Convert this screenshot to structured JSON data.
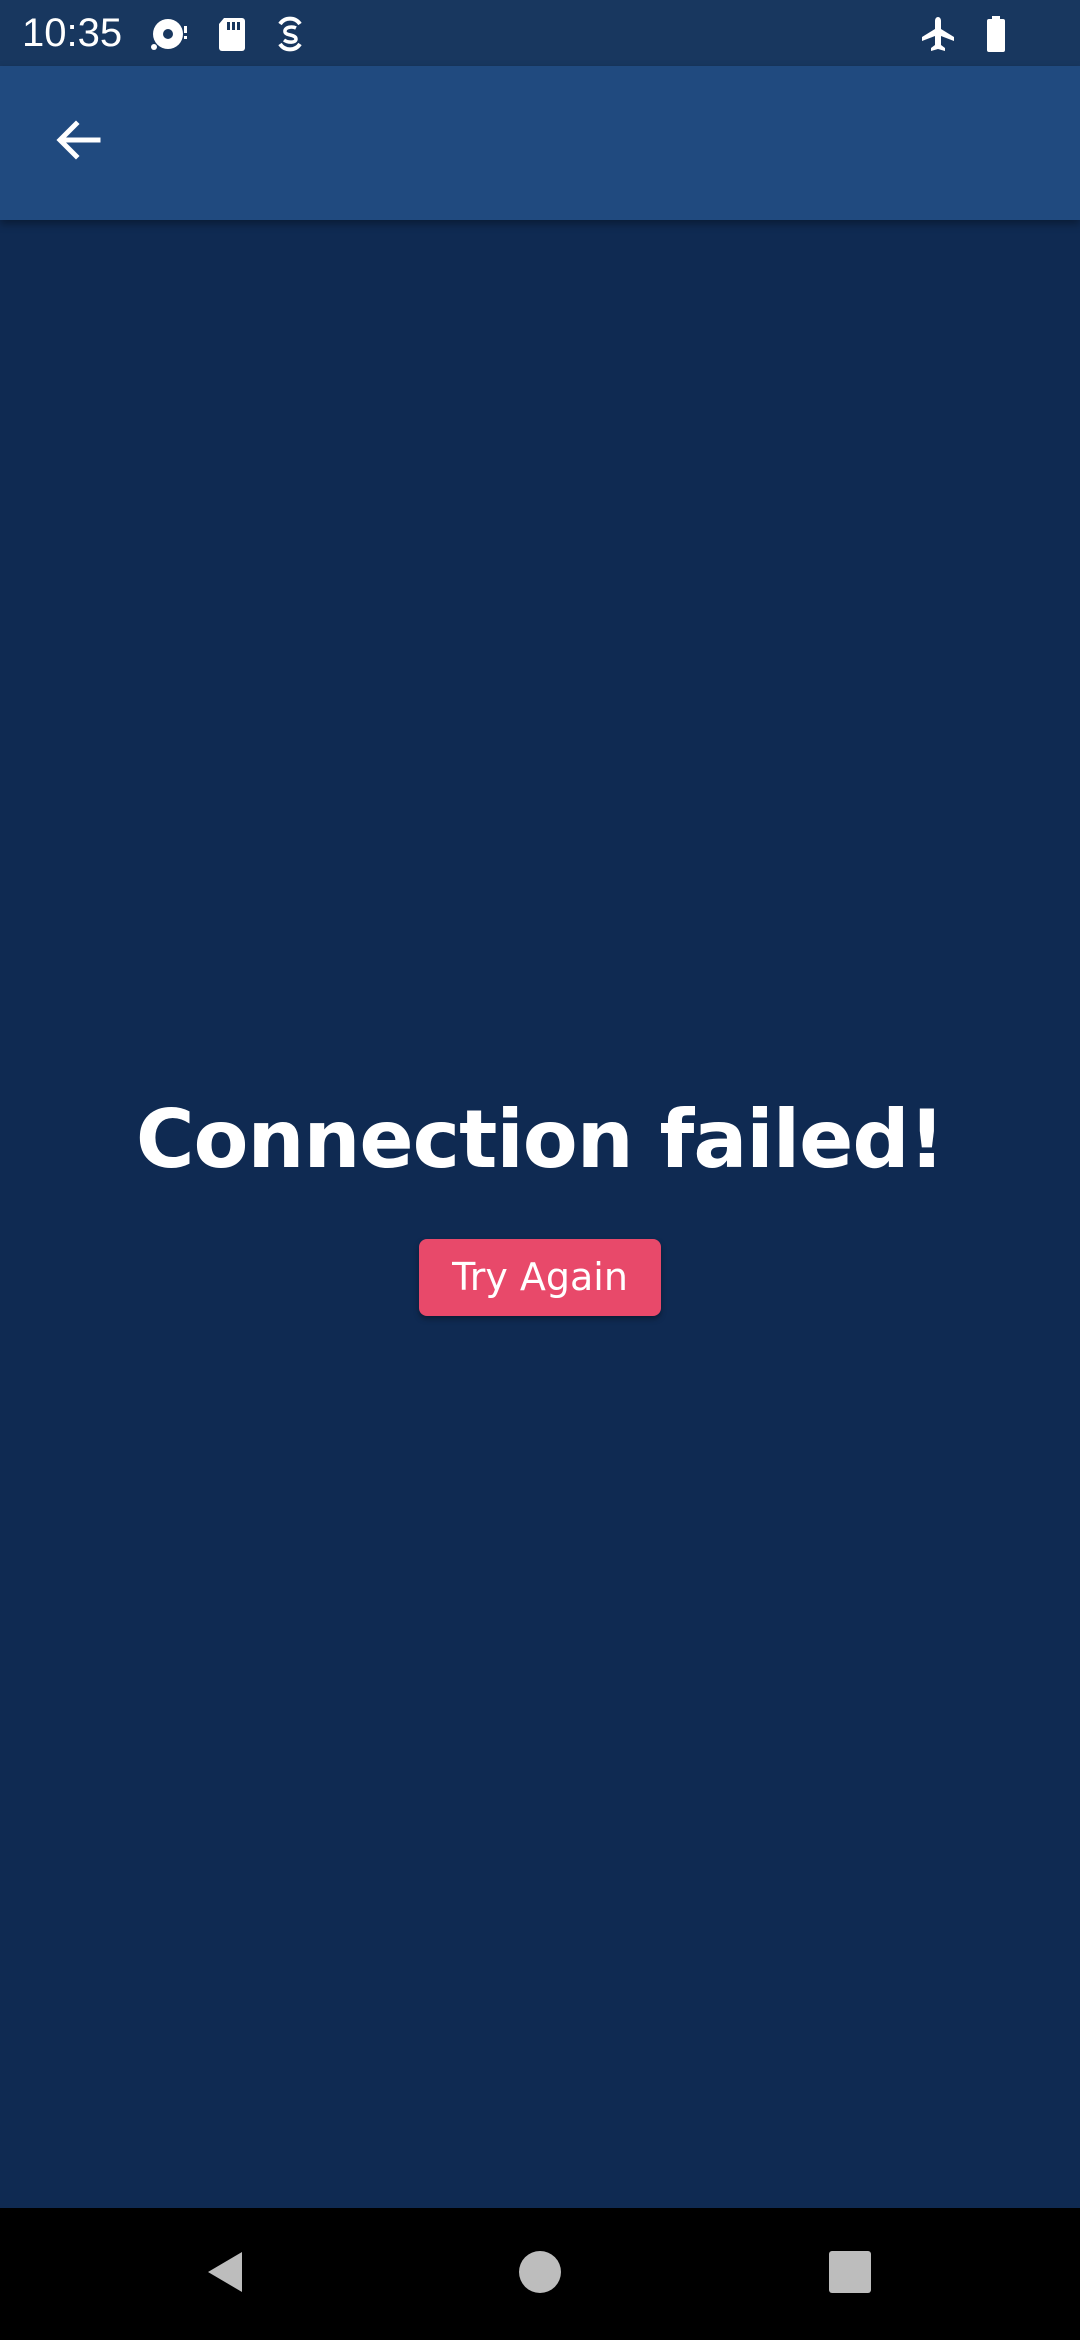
{
  "status_bar": {
    "time": "10:35",
    "left_icons": [
      "media-disc-icon",
      "sd-card-icon",
      "data-saver-icon"
    ],
    "right_icons": [
      "airplane-mode-icon",
      "battery-icon"
    ]
  },
  "app_bar": {
    "back_icon": "arrow-back-icon"
  },
  "main": {
    "message": "Connection failed!",
    "retry_label": "Try Again"
  },
  "nav_bar": {
    "buttons": [
      "back-triangle-icon",
      "home-circle-icon",
      "recents-square-icon"
    ]
  },
  "colors": {
    "background": "#0f2a52",
    "status_bar": "#18375f",
    "app_bar": "#204a7f",
    "accent_button": "#e8496a",
    "text": "#ffffff"
  }
}
